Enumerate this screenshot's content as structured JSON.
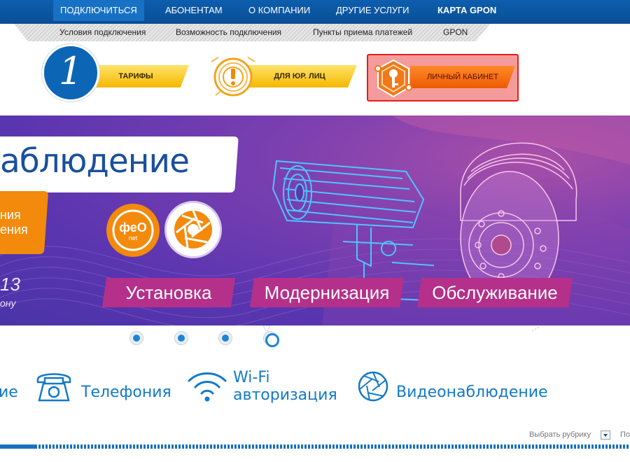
{
  "topnav": {
    "items": [
      "ПОДКЛЮЧИТЬСЯ",
      "АБОНЕНТАМ",
      "О КОМПАНИИ",
      "ДРУГИЕ УСЛУГИ",
      "КАРТА GPON"
    ]
  },
  "subnav": {
    "items": [
      "Условия подключения",
      "Возможность подключения",
      "Пункты приема платежей",
      "GPON"
    ]
  },
  "features": {
    "badge_number": "1",
    "tariffs": "ТАРИФЫ",
    "legal": "ДЛЯ ЮР. ЛИЦ",
    "cabinet": "ЛИЧНЫЙ КАБИНЕТ"
  },
  "banner": {
    "title": "аблюдение",
    "orange_line1": "ния",
    "orange_line2": "ения",
    "side_number": "13",
    "side_sub": "ону",
    "tags": [
      "Установка",
      "Модернизация",
      "Обслуживание"
    ],
    "logo_text": "феО",
    "logo_sub": "net"
  },
  "slider": {
    "count": 4,
    "active": 3
  },
  "services": {
    "partial": "ие",
    "telephony": "Телефония",
    "wifi_line1": "Wi-Fi",
    "wifi_line2": "авторизация",
    "video": "Видеонаблюдение"
  },
  "footer": {
    "rubric_label": "Выбрать рубрику",
    "cut_text": "По"
  },
  "colors": {
    "nav_blue": "#0d5eae",
    "accent_orange": "#f38a0b",
    "tag_magenta": "#b4308a",
    "service_blue": "#1479c7",
    "cabinet_red": "#e0201a"
  }
}
